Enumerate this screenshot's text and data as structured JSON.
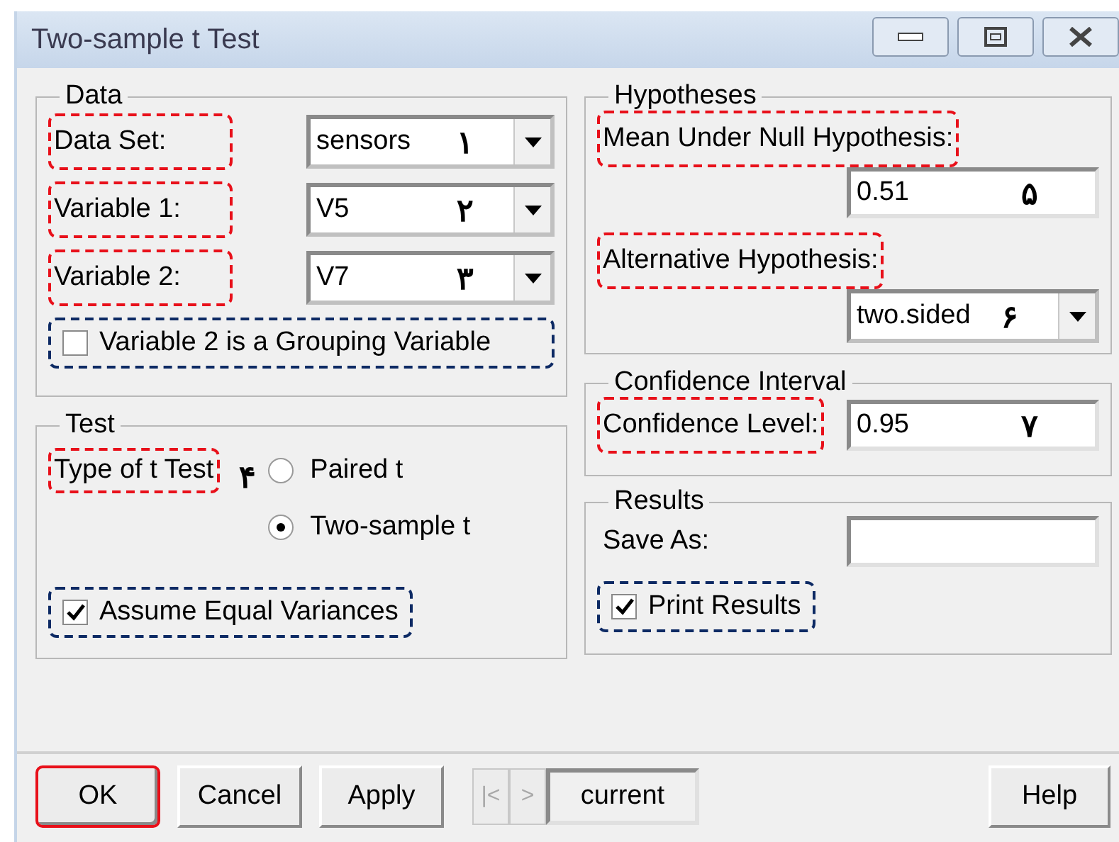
{
  "window": {
    "title": "Two-sample t Test"
  },
  "data": {
    "title": "Data",
    "fields": [
      {
        "label": "Data Set:",
        "value": "sensors",
        "color": "#e8101a",
        "marker": "۱"
      },
      {
        "label": "Variable 1:",
        "value": "V5",
        "color": "#e8101a",
        "marker": "۲"
      },
      {
        "label": "Variable 2:",
        "value": "V7",
        "color": "#e8101a",
        "marker": "۳"
      }
    ],
    "grouping": {
      "label": "Variable 2 is a Grouping Variable",
      "checked": false,
      "color": "#0d2a64"
    }
  },
  "test": {
    "title": "Test",
    "type_label": {
      "text": "Type of t Test",
      "color": "#e8101a",
      "marker": "۴"
    },
    "options": [
      {
        "label": "Paired t",
        "selected": false
      },
      {
        "label": "Two-sample t",
        "selected": true
      }
    ],
    "equal_variances": {
      "label": "Assume Equal Variances",
      "checked": true,
      "color": "#0d2a64"
    }
  },
  "hypotheses": {
    "title": "Hypotheses",
    "mean": {
      "label": "Mean Under Null Hypothesis:",
      "color": "#e8101a",
      "value": "0.51",
      "marker": "۵"
    },
    "alternative": {
      "label": "Alternative Hypothesis:",
      "color": "#e8101a",
      "value": "two.sided",
      "marker": "۶"
    }
  },
  "confidence": {
    "title": "Confidence Interval",
    "label": "Confidence Level:",
    "color": "#e8101a",
    "value": "0.95",
    "marker": "۷"
  },
  "results": {
    "title": "Results",
    "save_label": "Save As:",
    "print": {
      "label": "Print Results",
      "checked": true,
      "color": "#0d2a64"
    }
  },
  "buttons": [
    {
      "label": "OK",
      "color": "#e8101a"
    },
    {
      "label": "Cancel"
    },
    {
      "label": "Apply"
    }
  ],
  "nav": [
    {
      "label": "|<",
      "disabled": true
    },
    {
      "label": ">",
      "disabled": true
    }
  ],
  "current": "current",
  "help": "Help"
}
